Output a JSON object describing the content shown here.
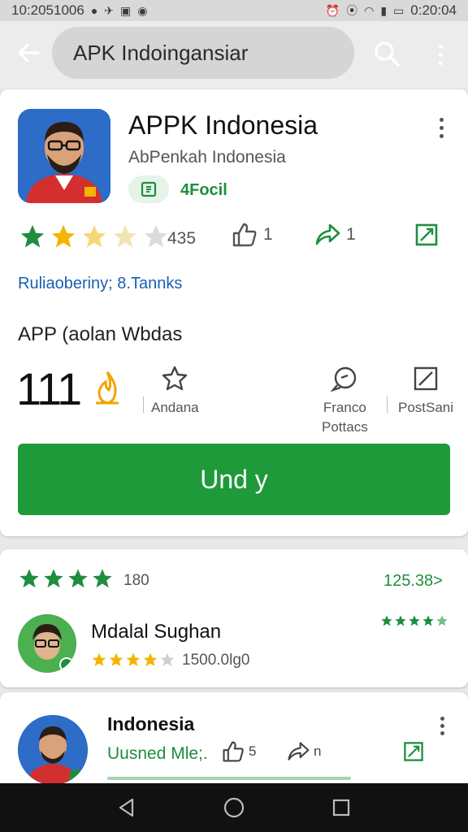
{
  "status_bar": {
    "time_left": "10:2051006",
    "time_right": "0:20:04"
  },
  "search": {
    "query": "APK Indoingansiar"
  },
  "app": {
    "title": "APPK Indonesia",
    "developer": "AbPenkah Indonesia",
    "badge": "4Focil",
    "rating_count": "435",
    "stat1": "1",
    "stat2": "1",
    "link": "Ruliaoberiny; 8.Tannks",
    "section_label": "APP (aolan Wbdas",
    "big_number": "111",
    "action_andana": "Andana",
    "action_franco_line1": "Franco",
    "action_franco_line2": "Pottacs",
    "action_post": "PostSani",
    "install_label": "Und y"
  },
  "review": {
    "count": "180",
    "link": "125.38>",
    "name": "Mdalal Sughan",
    "meta": "1500.0lg0"
  },
  "list_item": {
    "title": "Indonesia",
    "subtitle": "Uusned Mle;.",
    "stat1": "5",
    "stat2": "n"
  },
  "colors": {
    "accent_green": "#1f9a3a",
    "star_green": "#1e8e3e",
    "star_gold": "#f4b400",
    "link_blue": "#1a5fb4"
  }
}
